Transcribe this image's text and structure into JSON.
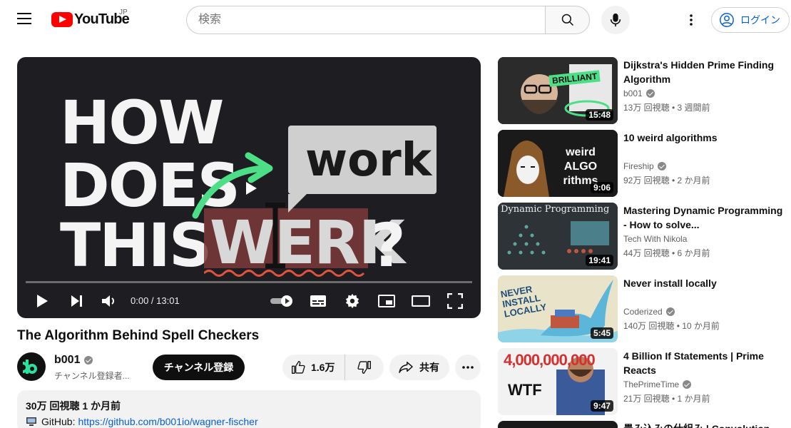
{
  "header": {
    "logo_text": "YouTube",
    "region": "JP",
    "search_placeholder": "検索",
    "login_label": "ログイン"
  },
  "player": {
    "thumbnail_lines": [
      "HOW",
      "DOES",
      "THIS",
      "WERK",
      "?"
    ],
    "bubble_text": "work",
    "time_display": "0:00 / 13:01",
    "progress_fraction": 0
  },
  "video": {
    "title": "The Algorithm Behind Spell Checkers",
    "channel_name": "b001",
    "subscribers": "チャンネル登録者...",
    "subscribe_label": "チャンネル登録",
    "likes": "1.6万",
    "share_label": "共有",
    "description_stats": "30万 回視聴  1 か月前",
    "github_label": "GitHub: ",
    "github_link": "https://github.com/b001io/wagner-fischer"
  },
  "recommendations": [
    {
      "title": "Dijkstra's Hidden Prime Finding Algorithm",
      "channel": "b001",
      "verified": true,
      "meta": "13万 回視聴 • 3 週間前",
      "duration": "15:48",
      "thumb_text": "BRILLIANT",
      "thumb_color": "#2b2b2b"
    },
    {
      "title": "10 weird algorithms",
      "channel": "Fireship",
      "verified": true,
      "meta": "92万 回視聴 • 2 か月前",
      "duration": "9:06",
      "thumb_text": "weird ALGO rithms",
      "thumb_color": "#1a1a1a"
    },
    {
      "title": "Mastering Dynamic Programming - How to solve...",
      "channel": "Tech With Nikola",
      "verified": false,
      "meta": "44万 回視聴 • 6 か月前",
      "duration": "19:41",
      "thumb_text": "Dynamic Programming",
      "thumb_color": "#2e3338"
    },
    {
      "title": "Never install locally",
      "channel": "Coderized",
      "verified": true,
      "meta": "140万 回視聴 • 10 か月前",
      "duration": "5:45",
      "thumb_text": "NEVER INSTALL LOCALLY",
      "thumb_color": "#e9e4c9"
    },
    {
      "title": "4 Billion If Statements | Prime Reacts",
      "channel": "ThePrimeTime",
      "verified": true,
      "meta": "21万 回視聴 • 1 か月前",
      "duration": "9:47",
      "thumb_text": "4,000,000,000",
      "thumb_color": "#f2f2f2"
    }
  ],
  "partial_rec_title": "畳み込みの仕組み | Convolution",
  "colors": {
    "brand_red": "#ff0000",
    "link_blue": "#065fd4",
    "chip_gray": "#f2f2f2"
  }
}
